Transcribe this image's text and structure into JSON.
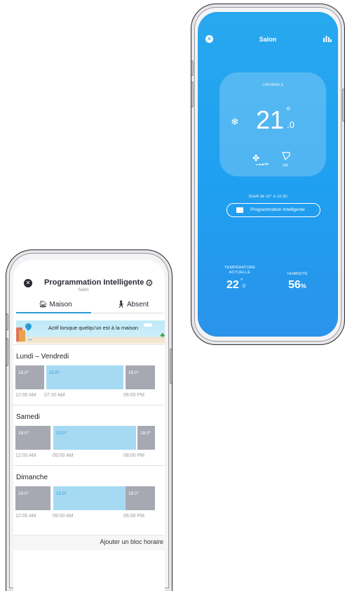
{
  "thermostat": {
    "title": "Salon",
    "mode_label": "Climatisé à",
    "set_temp": "21",
    "set_temp_degree": "°",
    "set_temp_decimal": ".0",
    "fan_icon": "fan-icon",
    "swing_icon": "swing-icon",
    "swing_label": "ON",
    "follow_text": "Suivit de 20° à 22:30",
    "program_button_label": "Programmation Intelligente",
    "current_temp_label": "TEMPÉRATURE ACTUELLE",
    "current_temp": "22",
    "current_temp_degree": "°",
    "current_temp_decimal": ".0",
    "humidity_label": "HUMIDITÉ",
    "humidity_value": "56",
    "humidity_unit": "%",
    "accent_color": "#1f9ff0"
  },
  "schedule": {
    "title": "Programmation Intelligente",
    "subtitle": "Salon",
    "tabs": [
      {
        "label": "Maison",
        "icon": "home-icon",
        "active": true
      },
      {
        "label": "Absent",
        "icon": "walking-person-icon",
        "active": false
      }
    ],
    "banner_text": "Actif lorsque quelqu'un est à la maison",
    "days": [
      {
        "name": "Lundi – Vendredi",
        "segments": [
          {
            "temp": "18.0°",
            "kind": "grey"
          },
          {
            "temp": "22.0°",
            "kind": "blue"
          },
          {
            "temp": "18.0°",
            "kind": "grey"
          }
        ],
        "times": [
          "12:00 AM",
          "07:30 AM",
          "06:00 PM"
        ]
      },
      {
        "name": "Samedi",
        "segments": [
          {
            "temp": "18.0°",
            "kind": "grey"
          },
          {
            "temp": "22.0°",
            "kind": "blue"
          },
          {
            "temp": "18.0°",
            "kind": "grey"
          }
        ],
        "times": [
          "12:00 AM",
          "09:00 AM",
          "08:00 PM"
        ]
      },
      {
        "name": "Dimanche",
        "segments": [
          {
            "temp": "18.0°",
            "kind": "grey"
          },
          {
            "temp": "23.0°",
            "kind": "blue"
          },
          {
            "temp": "18.0°",
            "kind": "grey"
          }
        ],
        "times": [
          "12:00 AM",
          "09:00 AM",
          "06:00 PM"
        ]
      }
    ],
    "add_block_label": "Ajouter un bloc horaire",
    "accent_color": "#2b9bd6"
  }
}
